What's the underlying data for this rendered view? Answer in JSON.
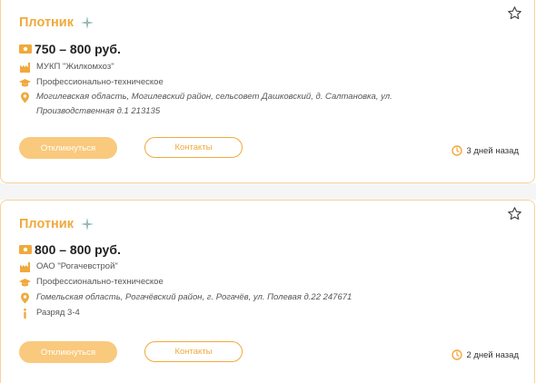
{
  "colors": {
    "accent": "#f0a93c",
    "accent_light": "#f9c97d",
    "border": "#f6d39a"
  },
  "vacancies": [
    {
      "title": "Плотник",
      "salary": "750 – 800 руб.",
      "company": "МУКП \"Жилкомхоз\"",
      "education": "Профессионально-техническое",
      "address": "Могилевская область, Могилевский район, сельсовет Дашковский, д. Салтановка, ул. Производственная д.1 213135",
      "apply_label": "Откликнуться",
      "contacts_label": "Контакты",
      "posted": "3 дней назад"
    },
    {
      "title": "Плотник",
      "salary": "800 – 800 руб.",
      "company": "ОАО \"Рогачевстрой\"",
      "education": "Профессионально-техническое",
      "address": "Гомельская область, Рогачёвский район, г. Рогачёв, ул. Полевая д.22 247671",
      "grade": "Разряд 3-4",
      "apply_label": "Откликнуться",
      "contacts_label": "Контакты",
      "posted": "2 дней назад"
    }
  ]
}
